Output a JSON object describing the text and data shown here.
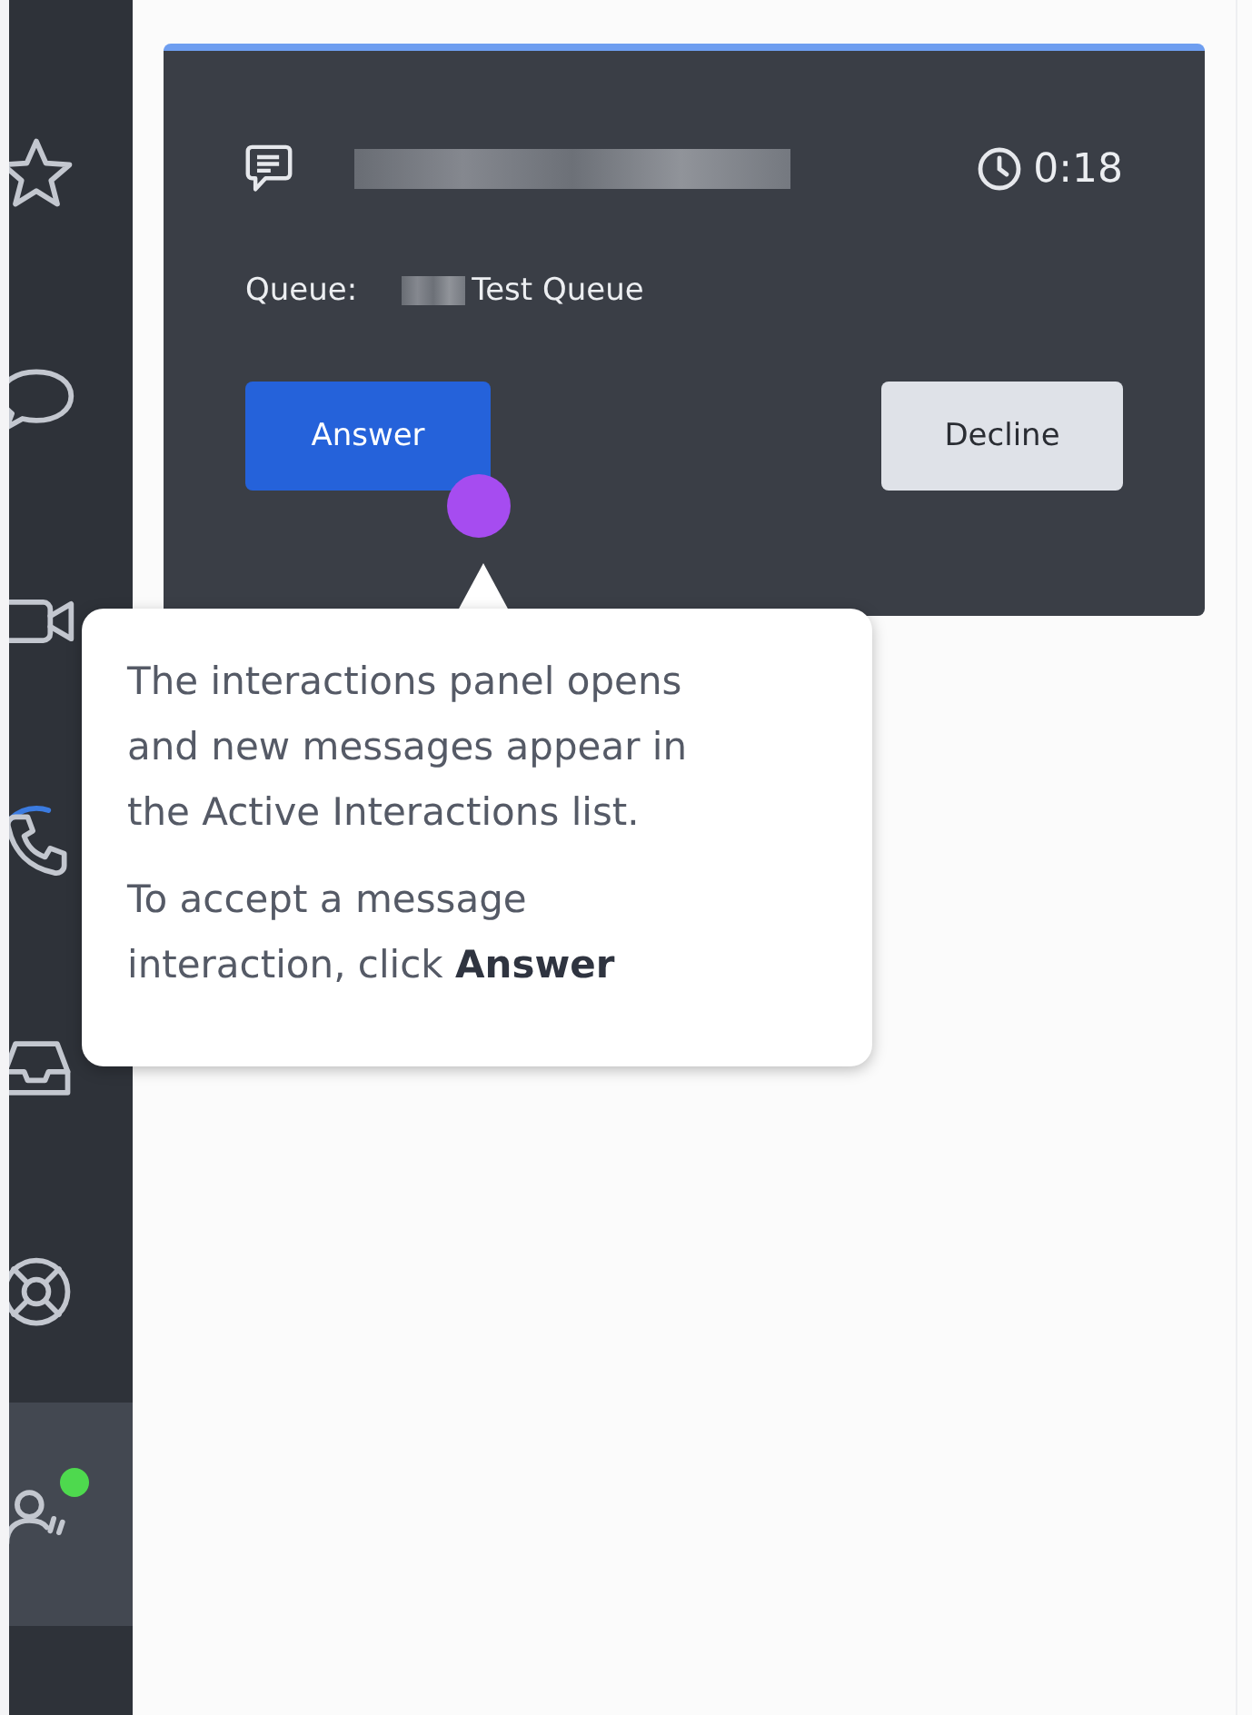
{
  "sidebar": {
    "items": [
      {
        "selected": false,
        "ringing": false,
        "badge": false
      },
      {
        "selected": false,
        "ringing": false,
        "badge": false
      },
      {
        "selected": false,
        "ringing": false,
        "badge": false
      },
      {
        "selected": false,
        "ringing": true,
        "badge": false
      },
      {
        "selected": false,
        "ringing": false,
        "badge": false
      },
      {
        "selected": false,
        "ringing": false,
        "badge": false
      },
      {
        "selected": true,
        "ringing": false,
        "badge": true
      }
    ]
  },
  "interaction": {
    "timer": "0:18",
    "queue_label": "Queue:",
    "queue_name": "Test Queue",
    "buttons": [
      {
        "label": "Answer",
        "kind": "primary"
      },
      {
        "label": "Decline",
        "kind": "secondary"
      }
    ]
  },
  "tooltip": {
    "paragraphs": [
      "The interactions panel opens and new messages appear in the Active Interactions list.",
      "To accept a message interaction, click **Answer**"
    ]
  }
}
